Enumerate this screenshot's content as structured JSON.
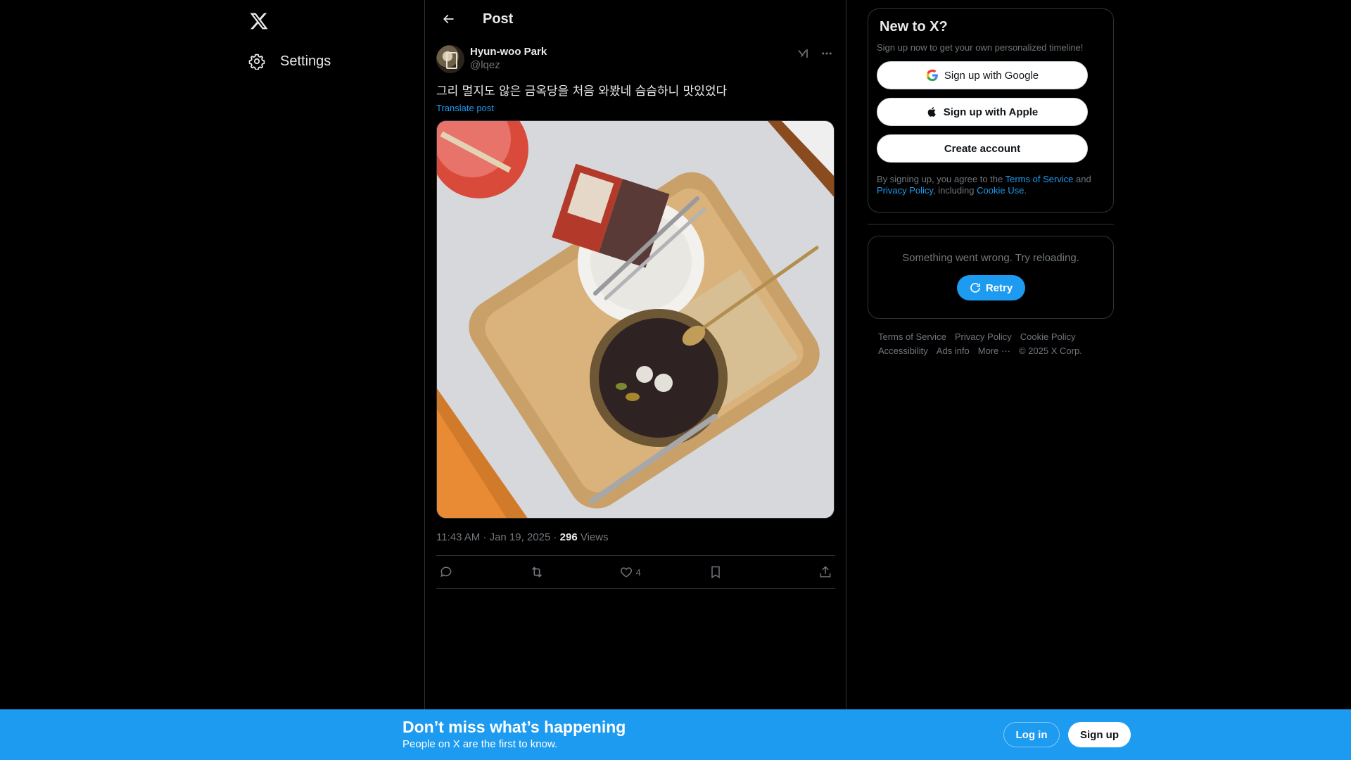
{
  "nav": {
    "settings_label": "Settings"
  },
  "header": {
    "title": "Post"
  },
  "post": {
    "author_name": "Hyun-woo Park",
    "author_handle": "@lqez",
    "text": "그리 멀지도 않은 금옥당을 처음 와봤네 슴슴하니 맛있었다",
    "translate_label": "Translate post",
    "timestamp": "11:43 AM · Jan 19, 2025 · ",
    "views_count": "296",
    "views_label": " Views",
    "like_count": "4"
  },
  "signup_card": {
    "title": "New to X?",
    "subtitle": "Sign up now to get your own personalized timeline!",
    "google_label": "Sign up with Google",
    "apple_label": "Sign up with Apple",
    "create_label": "Create account",
    "legal_prefix": "By signing up, you agree to the ",
    "terms_link": "Terms of Service",
    "legal_and": " and ",
    "privacy_link": "Privacy Policy",
    "legal_including": ", including ",
    "cookie_link": "Cookie Use."
  },
  "error_card": {
    "message": "Something went wrong. Try reloading.",
    "retry_label": "Retry"
  },
  "footer": {
    "links": [
      "Terms of Service",
      "Privacy Policy",
      "Cookie Policy",
      "Accessibility",
      "Ads info",
      "More ···",
      "© 2025 X Corp."
    ]
  },
  "bottom_bar": {
    "headline": "Don’t miss what’s happening",
    "subline": "People on X are the first to know.",
    "login_label": "Log in",
    "signup_label": "Sign up"
  },
  "colors": {
    "accent": "#1d9bf0",
    "background": "#000000",
    "border": "#2f3336",
    "muted_text": "#71767b"
  },
  "icons": [
    "x-logo-icon",
    "gear-icon",
    "back-arrow-icon",
    "grok-icon",
    "more-icon",
    "reply-icon",
    "repost-icon",
    "like-icon",
    "bookmark-icon",
    "share-icon",
    "google-icon",
    "apple-icon",
    "refresh-icon"
  ]
}
